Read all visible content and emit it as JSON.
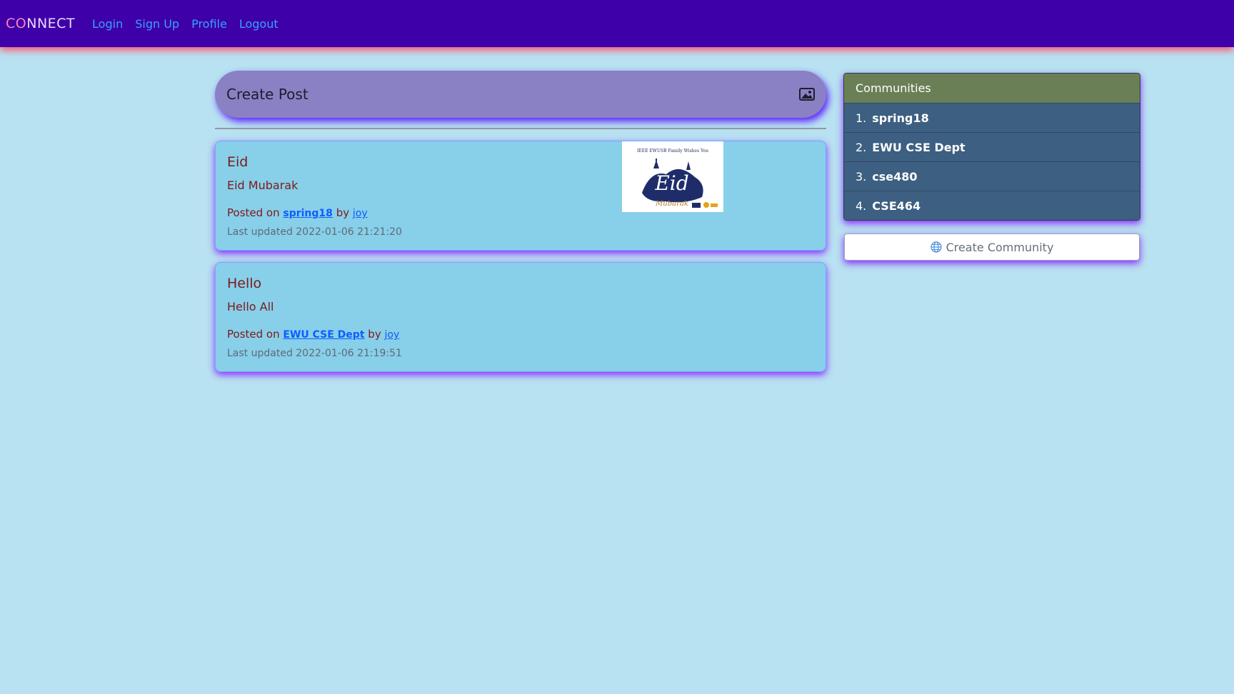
{
  "navbar": {
    "brand_part1": "CO",
    "brand_part2": "NNECT",
    "links": [
      "Login",
      "Sign Up",
      "Profile",
      "Logout"
    ]
  },
  "create_post": {
    "label": "Create Post",
    "icon": "image-icon"
  },
  "posts": [
    {
      "title": "Eid",
      "body": "Eid Mubarak",
      "posted_prefix": "Posted on",
      "community": "spring18",
      "by": "by",
      "author": "joy",
      "updated": "Last updated 2022-01-06 21:21:20",
      "image_caption": "IEEE EWUSB Family Wishes You",
      "image_title": "Eid",
      "image_subtitle": "Mubarak"
    },
    {
      "title": "Hello",
      "body": "Hello All",
      "posted_prefix": "Posted on",
      "community": "EWU CSE Dept",
      "by": "by",
      "author": "joy",
      "updated": "Last updated 2022-01-06 21:19:51"
    }
  ],
  "communities": {
    "header": "Communities",
    "items": [
      {
        "num": "1.",
        "name": "spring18"
      },
      {
        "num": "2.",
        "name": "EWU CSE Dept"
      },
      {
        "num": "3.",
        "name": "cse480"
      },
      {
        "num": "4.",
        "name": "CSE464"
      }
    ]
  },
  "create_community": {
    "label": "Create Community",
    "icon": "globe-icon"
  },
  "colors": {
    "page_bg": "#b8e1f1",
    "navbar_bg": "#3e00a8",
    "card_bg": "#88cfe9",
    "communities_header_bg": "#6a7f55",
    "communities_item_bg": "#3d5f81",
    "accent_shadow": "#8a2cff"
  }
}
